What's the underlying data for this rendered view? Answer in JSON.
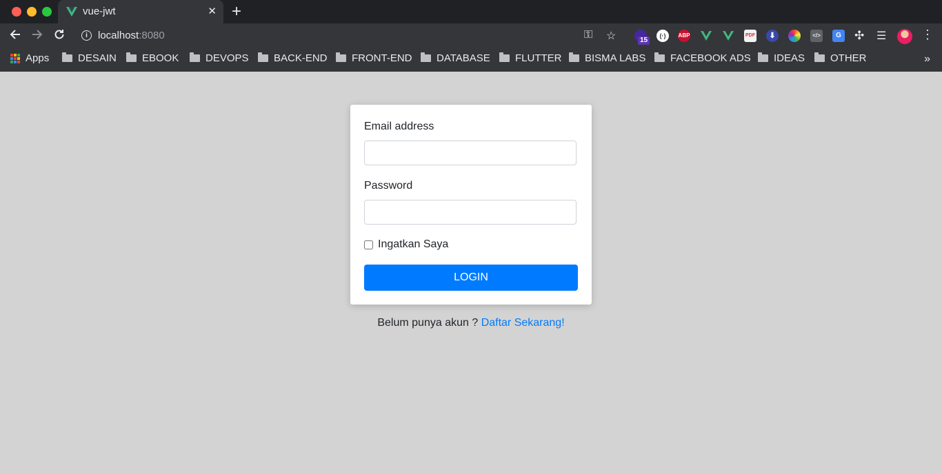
{
  "browser": {
    "tab": {
      "title": "vue-jwt",
      "close": "✕"
    },
    "new_tab": "+",
    "address": {
      "host": "localhost",
      "port": ":8080"
    },
    "extensions": {
      "badge_count": "15",
      "abp_label": "ABP",
      "pdf_label": "PDF",
      "code_label": "</>",
      "translate_label": "G"
    },
    "bookmarks": [
      {
        "label": "Apps",
        "icon": "apps-grid-icon"
      },
      {
        "label": "DESAIN",
        "icon": "folder-icon"
      },
      {
        "label": "EBOOK",
        "icon": "folder-icon"
      },
      {
        "label": "DEVOPS",
        "icon": "folder-icon"
      },
      {
        "label": "BACK-END",
        "icon": "folder-icon"
      },
      {
        "label": "FRONT-END",
        "icon": "folder-icon"
      },
      {
        "label": "DATABASE",
        "icon": "folder-icon"
      },
      {
        "label": "FLUTTER",
        "icon": "folder-icon"
      },
      {
        "label": "BISMA LABS",
        "icon": "folder-icon"
      },
      {
        "label": "FACEBOOK ADS",
        "icon": "folder-icon"
      },
      {
        "label": "IDEAS",
        "icon": "folder-icon"
      },
      {
        "label": "OTHER",
        "icon": "folder-icon"
      }
    ],
    "more_bookmarks": "»"
  },
  "login_form": {
    "email_label": "Email address",
    "email_value": "",
    "password_label": "Password",
    "password_value": "",
    "remember_label": "Ingatkan Saya",
    "remember_checked": false,
    "submit_label": "LOGIN"
  },
  "register": {
    "prompt": "Belum punya akun ?",
    "link_text": "Daftar Sekarang!"
  },
  "colors": {
    "page_background": "#d3d3d3",
    "primary": "#007bff",
    "chrome_toolbar": "#35363a",
    "chrome_tabstrip": "#202124",
    "vue_green": "#41b883"
  }
}
